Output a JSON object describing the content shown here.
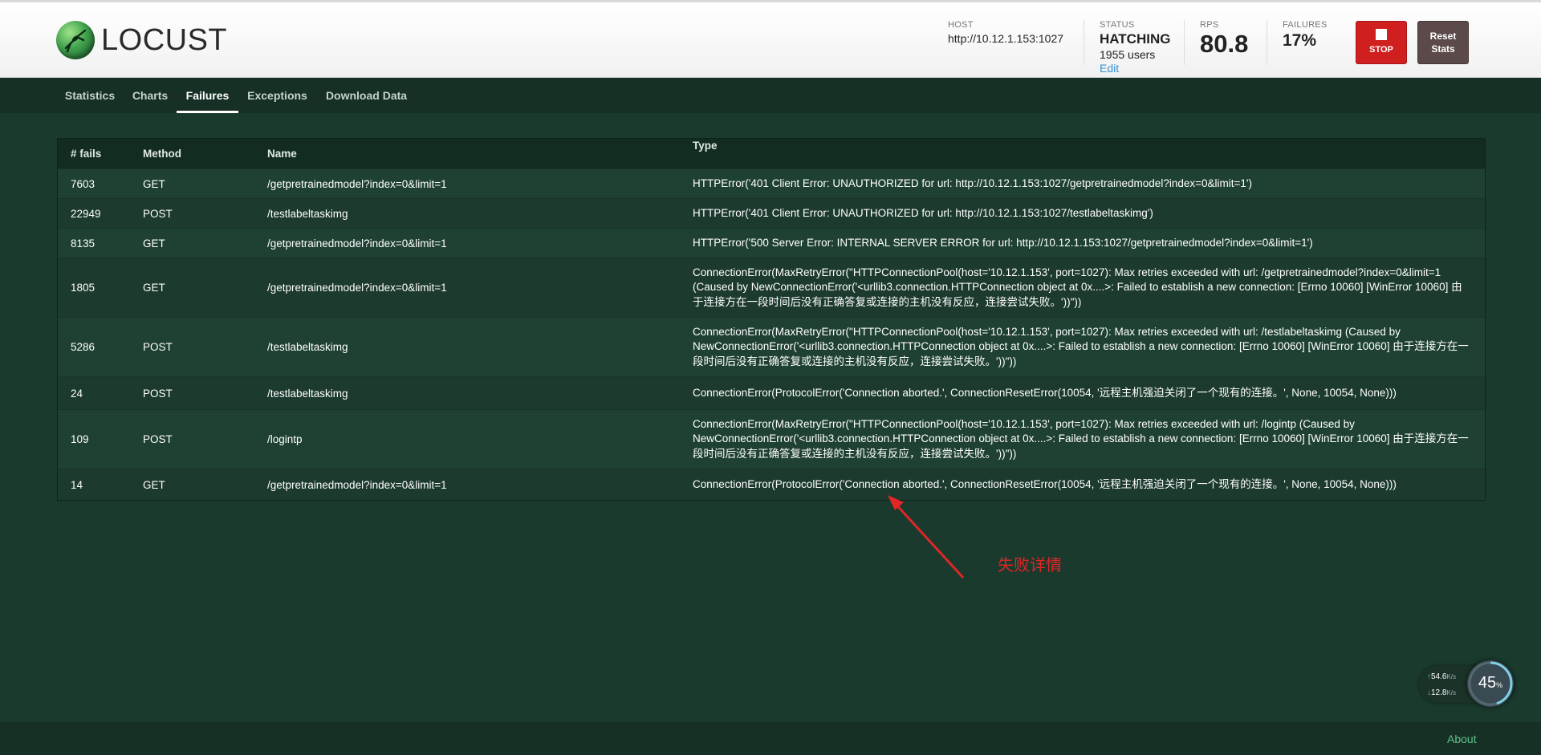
{
  "app": {
    "logo_text": "LOCUST"
  },
  "header": {
    "host_label": "HOST",
    "host_value": "http://10.12.1.153:1027",
    "status_label": "STATUS",
    "status_value": "HATCHING",
    "users": "1955 users",
    "edit_label": "Edit",
    "rps_label": "RPS",
    "rps_value": "80.8",
    "failures_label": "FAILURES",
    "failures_value": "17%",
    "stop_label": "STOP",
    "reset_label_line1": "Reset",
    "reset_label_line2": "Stats"
  },
  "nav": {
    "tabs": [
      {
        "label": "Statistics"
      },
      {
        "label": "Charts"
      },
      {
        "label": "Failures"
      },
      {
        "label": "Exceptions"
      },
      {
        "label": "Download Data"
      }
    ],
    "active": "Failures"
  },
  "failures_table": {
    "columns": [
      "# fails",
      "Method",
      "Name",
      "Type"
    ],
    "rows": [
      {
        "fails": "7603",
        "method": "GET",
        "name": "/getpretrainedmodel?index=0&limit=1",
        "type": "HTTPError('401 Client Error: UNAUTHORIZED for url: http://10.12.1.153:1027/getpretrainedmodel?index=0&limit=1')"
      },
      {
        "fails": "22949",
        "method": "POST",
        "name": "/testlabeltaskimg",
        "type": "HTTPError('401 Client Error: UNAUTHORIZED for url: http://10.12.1.153:1027/testlabeltaskimg')"
      },
      {
        "fails": "8135",
        "method": "GET",
        "name": "/getpretrainedmodel?index=0&limit=1",
        "type": "HTTPError('500 Server Error: INTERNAL SERVER ERROR for url: http://10.12.1.153:1027/getpretrainedmodel?index=0&limit=1')"
      },
      {
        "fails": "1805",
        "method": "GET",
        "name": "/getpretrainedmodel?index=0&limit=1",
        "type": "ConnectionError(MaxRetryError(\"HTTPConnectionPool(host='10.12.1.153', port=1027): Max retries exceeded with url: /getpretrainedmodel?index=0&limit=1 (Caused by NewConnectionError('<urllib3.connection.HTTPConnection object at 0x....>: Failed to establish a new connection: [Errno 10060] [WinError 10060] 由于连接方在一段时间后没有正确答复或连接的主机没有反应，连接尝试失败。'))\"))"
      },
      {
        "fails": "5286",
        "method": "POST",
        "name": "/testlabeltaskimg",
        "type": "ConnectionError(MaxRetryError(\"HTTPConnectionPool(host='10.12.1.153', port=1027): Max retries exceeded with url: /testlabeltaskimg (Caused by NewConnectionError('<urllib3.connection.HTTPConnection object at 0x....>: Failed to establish a new connection: [Errno 10060] [WinError 10060] 由于连接方在一段时间后没有正确答复或连接的主机没有反应，连接尝试失败。'))\"))"
      },
      {
        "fails": "24",
        "method": "POST",
        "name": "/testlabeltaskimg",
        "type": "ConnectionError(ProtocolError('Connection aborted.', ConnectionResetError(10054, '远程主机强迫关闭了一个现有的连接。', None, 10054, None)))"
      },
      {
        "fails": "109",
        "method": "POST",
        "name": "/logintp",
        "type": "ConnectionError(MaxRetryError(\"HTTPConnectionPool(host='10.12.1.153', port=1027): Max retries exceeded with url: /logintp (Caused by NewConnectionError('<urllib3.connection.HTTPConnection object at 0x....>: Failed to establish a new connection: [Errno 10060] [WinError 10060] 由于连接方在一段时间后没有正确答复或连接的主机没有反应，连接尝试失败。'))\"))"
      },
      {
        "fails": "14",
        "method": "GET",
        "name": "/getpretrainedmodel?index=0&limit=1",
        "type": "ConnectionError(ProtocolError('Connection aborted.', ConnectionResetError(10054, '远程主机强迫关闭了一个现有的连接。', None, 10054, None)))"
      }
    ]
  },
  "annotation": {
    "text": "失败详情",
    "color": "#e02626"
  },
  "net_widget": {
    "upload": "54.6",
    "upload_unit": "K/s",
    "download": "12.8",
    "download_unit": "K/s",
    "load_percent": "45",
    "load_unit": "%"
  },
  "footer": {
    "about_label": "About"
  },
  "colors": {
    "background": "#1a3a2e",
    "stop": "#d01f1f",
    "link": "#3a8fd0",
    "about": "#5fc38a"
  }
}
